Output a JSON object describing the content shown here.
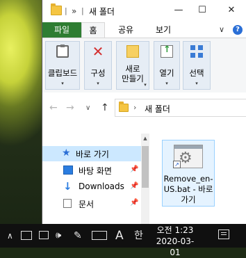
{
  "window": {
    "title": "새 폴더",
    "breadcrumb_chevron": "»",
    "controls": {
      "minimize": "—",
      "maximize": "☐",
      "close": "✕"
    }
  },
  "tabs": {
    "file": "파일",
    "items": [
      {
        "label": "홈"
      },
      {
        "label": "공유"
      },
      {
        "label": "보기"
      }
    ],
    "collapse_chevron": "∨",
    "help": "?"
  },
  "ribbon": {
    "groups": [
      {
        "label": "클립보드",
        "icon": "clipboard-icon",
        "arrow": "▾"
      },
      {
        "label": "구성",
        "icon": "organize-icon",
        "arrow": "▾"
      },
      {
        "label": "새로\n만들기",
        "icon": "new-folder-icon",
        "arrow": "▾"
      },
      {
        "label": "열기",
        "icon": "open-icon",
        "arrow": "▾"
      },
      {
        "label": "선택",
        "icon": "select-icon",
        "arrow": "▾"
      }
    ]
  },
  "address": {
    "back": "←",
    "forward": "→",
    "history": "∨",
    "up": "↑",
    "chevron": "›",
    "path": "새 폴더"
  },
  "navpane": {
    "items": [
      {
        "label": "바로 가기",
        "icon": "star-icon"
      },
      {
        "label": "바탕 화면",
        "icon": "desktop-icon",
        "pin": "📌"
      },
      {
        "label": "Downloads",
        "icon": "download-icon",
        "pin": "📌"
      },
      {
        "label": "문서",
        "icon": "document-icon",
        "pin": "📌"
      }
    ]
  },
  "content": {
    "file": {
      "name": "Remove_en-US.bat - 바로 가기"
    }
  },
  "taskbar": {
    "ime_mode": "A",
    "ime_lang": "한",
    "time": "오전 1:23",
    "date": "2020-03-01"
  },
  "colors": {
    "file_tab": "#2e7d32",
    "selection": "#cce8ff",
    "taskbar": "#101010"
  }
}
